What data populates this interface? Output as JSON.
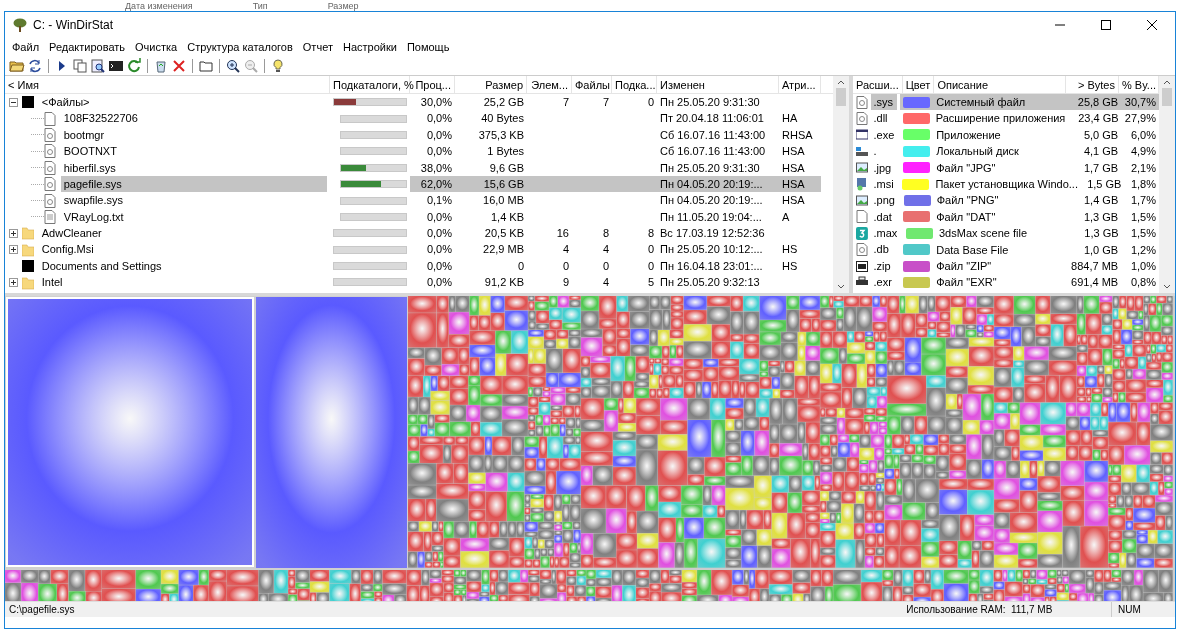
{
  "background_window": {
    "column_headers": [
      "Дата изменения",
      "Тип",
      "Размер"
    ]
  },
  "window": {
    "title": "C: - WinDirStat"
  },
  "menu": [
    "Файл",
    "Редактировать",
    "Очистка",
    "Структура каталогов",
    "Отчет",
    "Настройки",
    "Помощь"
  ],
  "tree": {
    "columns": [
      "< Имя",
      "Подкаталоги, %",
      "Проц...",
      "Размер",
      "Элем...",
      "Файлы",
      "Подка...",
      "Изменен",
      "Атри..."
    ],
    "rows": [
      {
        "kind": "files-group",
        "name": "<Файлы>",
        "level": 0.3,
        "percent": "30,0%",
        "size": "25,2 GB",
        "items": "7",
        "files": "7",
        "subdirs": "0",
        "modified": "Пн 25.05.20  9:31:30",
        "attributes": "",
        "selected": false,
        "expanded": true,
        "children": [
          {
            "kind": "file",
            "name": "108F32522706",
            "level": 0,
            "percent": "0,0%",
            "size": "40 Bytes",
            "modified": "Пт 20.04.18  11:06:01",
            "attributes": "HA",
            "selected": false
          },
          {
            "kind": "system-file",
            "name": "bootmgr",
            "level": 0,
            "percent": "0,0%",
            "size": "375,3 KB",
            "modified": "Сб 16.07.16  11:43:00",
            "attributes": "RHSA",
            "selected": false
          },
          {
            "kind": "system-file",
            "name": "BOOTNXT",
            "level": 0,
            "percent": "0,0%",
            "size": "1 Bytes",
            "modified": "Сб 16.07.16  11:43:00",
            "attributes": "HSA",
            "selected": false
          },
          {
            "kind": "system-file",
            "name": "hiberfil.sys",
            "level": 0.38,
            "percent": "38,0%",
            "size": "9,6 GB",
            "modified": "Пн 25.05.20  9:31:30",
            "attributes": "HSA",
            "selected": false
          },
          {
            "kind": "system-file",
            "name": "pagefile.sys",
            "level": 0.62,
            "percent": "62,0%",
            "size": "15,6 GB",
            "modified": "Пн 04.05.20  20:19:...",
            "attributes": "HSA",
            "selected": true
          },
          {
            "kind": "system-file",
            "name": "swapfile.sys",
            "level": 0.001,
            "percent": "0,1%",
            "size": "16,0 MB",
            "modified": "Пн 04.05.20  20:19:...",
            "attributes": "HSA",
            "selected": false
          },
          {
            "kind": "text-file",
            "name": "VRayLog.txt",
            "level": 0,
            "percent": "0,0%",
            "size": "1,4 KB",
            "modified": "Пн 11.05.20  19:04:...",
            "attributes": "A",
            "selected": false
          }
        ]
      },
      {
        "kind": "folder",
        "name": "AdwCleaner",
        "level": 0,
        "percent": "0,0%",
        "size": "20,5 KB",
        "items": "16",
        "files": "8",
        "subdirs": "8",
        "modified": "Вс 17.03.19  12:52:36",
        "attributes": "",
        "selected": false,
        "expanded": false
      },
      {
        "kind": "folder",
        "name": "Config.Msi",
        "level": 0,
        "percent": "0,0%",
        "size": "22,9 MB",
        "items": "4",
        "files": "4",
        "subdirs": "0",
        "modified": "Пн 25.05.20  10:12:...",
        "attributes": "HS",
        "selected": false,
        "expanded": false
      },
      {
        "kind": "junction",
        "name": "Documents and Settings",
        "level": 0,
        "percent": "0,0%",
        "size": "0",
        "items": "0",
        "files": "0",
        "subdirs": "0",
        "modified": "Пн 16.04.18  23:01:...",
        "attributes": "HS",
        "selected": false
      },
      {
        "kind": "folder",
        "name": "Intel",
        "level": 0,
        "percent": "0,0%",
        "size": "91,2 KB",
        "items": "9",
        "files": "4",
        "subdirs": "5",
        "modified": "Пн 25.05.20  9:32:13",
        "attributes": "",
        "selected": false,
        "expanded": false
      }
    ]
  },
  "extensions": {
    "columns": [
      "Расши...",
      "Цвет",
      "Описание",
      "> Bytes",
      "% By..."
    ],
    "rows": [
      {
        "kind": "system",
        "ext": ".sys",
        "color": "#6868ff",
        "description": "Системный файл",
        "bytes": "25,8 GB",
        "percent": "30,7%",
        "selected": true
      },
      {
        "kind": "system",
        "ext": ".dll",
        "color": "#ff6868",
        "description": "Расширение приложения",
        "bytes": "23,4 GB",
        "percent": "27,9%",
        "selected": false
      },
      {
        "kind": "app",
        "ext": ".exe",
        "color": "#68ff68",
        "description": "Приложение",
        "bytes": "5,0 GB",
        "percent": "6,0%",
        "selected": false
      },
      {
        "kind": "drive",
        "ext": ".",
        "color": "#44eeee",
        "description": "Локальный диск",
        "bytes": "4,1 GB",
        "percent": "4,9%",
        "selected": false
      },
      {
        "kind": "image",
        "ext": ".jpg",
        "color": "#ff22ff",
        "description": "Файл \"JPG\"",
        "bytes": "1,7 GB",
        "percent": "2,1%",
        "selected": false
      },
      {
        "kind": "installer",
        "ext": ".msi",
        "color": "#ffff22",
        "description": "Пакет установщика Windo...",
        "bytes": "1,5 GB",
        "percent": "1,8%",
        "selected": false
      },
      {
        "kind": "image",
        "ext": ".png",
        "color": "#7070e8",
        "description": "Файл \"PNG\"",
        "bytes": "1,4 GB",
        "percent": "1,7%",
        "selected": false
      },
      {
        "kind": "blank",
        "ext": ".dat",
        "color": "#e87070",
        "description": "Файл \"DAT\"",
        "bytes": "1,3 GB",
        "percent": "1,5%",
        "selected": false
      },
      {
        "kind": "max",
        "ext": ".max",
        "color": "#70e870",
        "description": "3dsMax scene file",
        "bytes": "1,3 GB",
        "percent": "1,5%",
        "selected": false
      },
      {
        "kind": "system",
        "ext": ".db",
        "color": "#50c8c8",
        "description": "Data Base File",
        "bytes": "1,0 GB",
        "percent": "1,2%",
        "selected": false
      },
      {
        "kind": "archive",
        "ext": ".zip",
        "color": "#c850c8",
        "description": "Файл \"ZIP\"",
        "bytes": "884,7 MB",
        "percent": "1,0%",
        "selected": false
      },
      {
        "kind": "printer",
        "ext": ".exr",
        "color": "#c8c850",
        "description": "Файл \"EXR\"",
        "bytes": "691,4 MB",
        "percent": "0,8%",
        "selected": false
      }
    ]
  },
  "status_bar": {
    "path": "C:\\pagefile.sys",
    "ram_label": "Использование RAM:",
    "ram_value": "111,7 MB",
    "keyboard": "NUM"
  }
}
